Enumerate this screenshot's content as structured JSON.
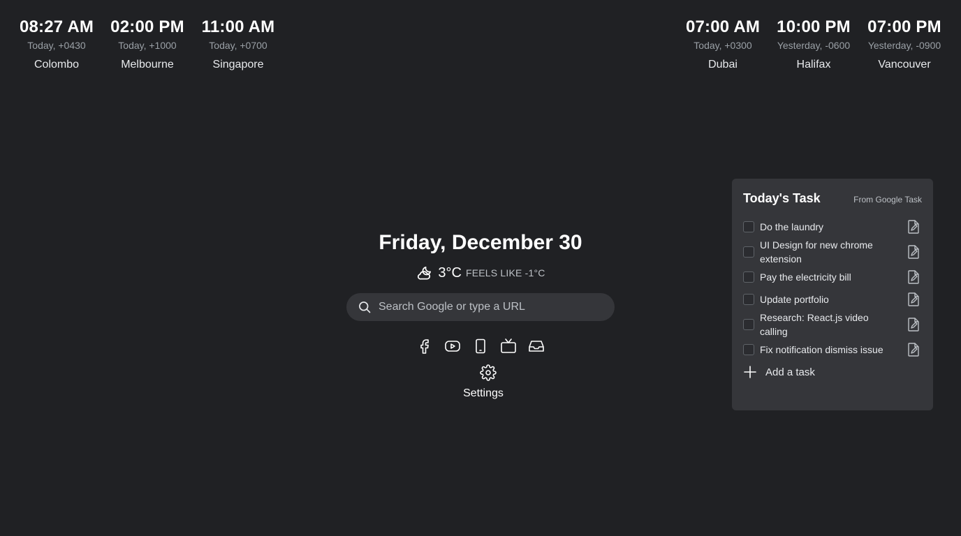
{
  "clocks_left": [
    {
      "time": "08:27 AM",
      "offset": "Today, +0430",
      "city": "Colombo"
    },
    {
      "time": "02:00 PM",
      "offset": "Today, +1000",
      "city": "Melbourne"
    },
    {
      "time": "11:00 AM",
      "offset": "Today, +0700",
      "city": "Singapore"
    }
  ],
  "clocks_right": [
    {
      "time": "07:00 AM",
      "offset": "Today, +0300",
      "city": "Dubai"
    },
    {
      "time": "10:00 PM",
      "offset": "Yesterday, -0600",
      "city": "Halifax"
    },
    {
      "time": "07:00 PM",
      "offset": "Yesterday, -0900",
      "city": "Vancouver"
    }
  ],
  "date": "Friday, December 30",
  "weather": {
    "icon": "cloud-moon-icon",
    "temp": "3°C",
    "feels": "FEELS LIKE -1°C"
  },
  "search": {
    "placeholder": "Search Google or type a URL",
    "icon": "search-icon"
  },
  "shortcuts": [
    {
      "name": "facebook-icon"
    },
    {
      "name": "youtube-icon"
    },
    {
      "name": "phone-icon"
    },
    {
      "name": "tv-icon"
    },
    {
      "name": "inbox-icon"
    }
  ],
  "settings": {
    "label": "Settings",
    "icon": "gear-icon"
  },
  "tasks": {
    "title": "Today's Task",
    "source": "From Google Task",
    "items": [
      {
        "text": "Do the laundry"
      },
      {
        "text": "UI Design for new chrome extension"
      },
      {
        "text": "Pay the electricity bill"
      },
      {
        "text": "Update portfolio"
      },
      {
        "text": "Research: React.js video calling"
      },
      {
        "text": "Fix notification dismiss issue"
      }
    ],
    "add_label": "Add a task"
  },
  "colors": {
    "background": "#202124",
    "panel": "#35363a",
    "text": "#e8eaed"
  }
}
